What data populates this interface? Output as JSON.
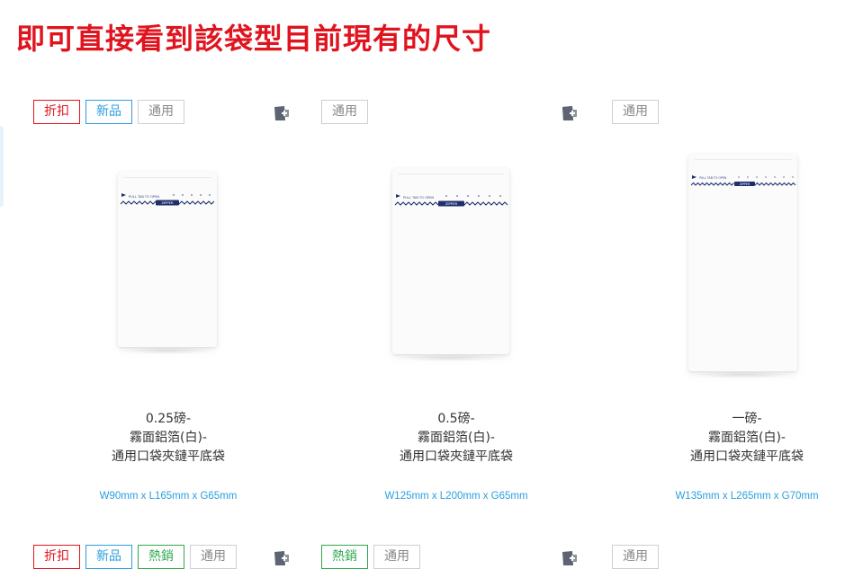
{
  "page": {
    "title": "即可直接看到該袋型目前現有的尺寸"
  },
  "products": [
    {
      "tags": [
        {
          "label": "折扣",
          "kind": "discount"
        },
        {
          "label": "新品",
          "kind": "new"
        },
        {
          "label": "通用",
          "kind": "general"
        }
      ],
      "compare_icon": "compare-add-icon",
      "name_lines": [
        "0.25磅-",
        "霧面鋁箔(白)-",
        "通用口袋夾鏈平底袋"
      ],
      "size": "W90mm x L165mm x G65mm",
      "bag_label": "PULL TAB TO OPEN",
      "bag_badge": "ZIPPER"
    },
    {
      "tags": [
        {
          "label": "通用",
          "kind": "general"
        }
      ],
      "compare_icon": "compare-add-icon",
      "name_lines": [
        "0.5磅-",
        "霧面鋁箔(白)-",
        "通用口袋夾鏈平底袋"
      ],
      "size": "W125mm x L200mm x G65mm",
      "bag_label": "PULL TAB TO OPEN",
      "bag_badge": "ZIPPER"
    },
    {
      "tags": [
        {
          "label": "通用",
          "kind": "general"
        }
      ],
      "compare_icon": "compare-add-icon",
      "name_lines": [
        "一磅-",
        "霧面鋁箔(白)-",
        "通用口袋夾鏈平底袋"
      ],
      "size": "W135mm x L265mm x G70mm",
      "bag_label": "PULL TAB TO OPEN",
      "bag_badge": "ZIPPER"
    }
  ],
  "next_row": [
    {
      "tags": [
        {
          "label": "折扣",
          "kind": "discount"
        },
        {
          "label": "新品",
          "kind": "new"
        },
        {
          "label": "熱銷",
          "kind": "hot"
        },
        {
          "label": "通用",
          "kind": "general"
        }
      ],
      "compare_icon": "compare-add-icon"
    },
    {
      "tags": [
        {
          "label": "熱銷",
          "kind": "hot"
        },
        {
          "label": "通用",
          "kind": "general"
        }
      ],
      "compare_icon": "compare-add-icon"
    },
    {
      "tags": [
        {
          "label": "通用",
          "kind": "general"
        }
      ],
      "compare_icon": "compare-add-icon"
    }
  ]
}
